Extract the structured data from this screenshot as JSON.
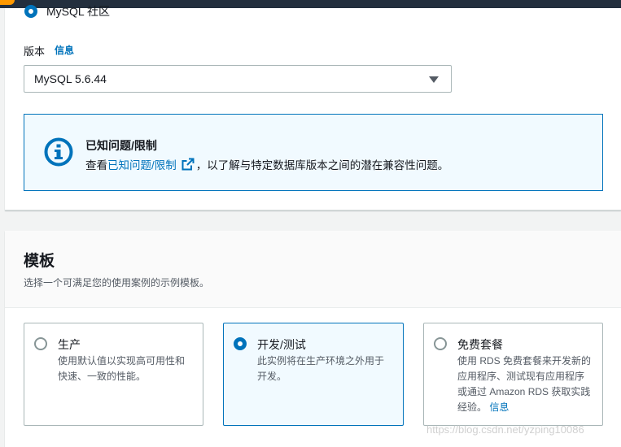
{
  "edition": {
    "label": "MySQL 社区"
  },
  "version": {
    "label": "版本",
    "info_link": "信息",
    "selected": "MySQL 5.6.44"
  },
  "alert": {
    "title": "已知问题/限制",
    "prefix": "查看",
    "link_text": "已知问题/限制",
    "suffix": "，以了解与特定数据库版本之间的潜在兼容性问题。"
  },
  "templates": {
    "title": "模板",
    "description": "选择一个可满足您的使用案例的示例模板。",
    "options": [
      {
        "title": "生产",
        "desc_lines": [
          "使用默认值以实现高可用性和",
          "快速、一致的性能。"
        ],
        "selected": false
      },
      {
        "title": "开发/测试",
        "desc_lines": [
          "此实例将在生产环境之外用于",
          "开发。"
        ],
        "selected": true
      },
      {
        "title": "免费套餐",
        "desc_lines": [
          "使用 RDS 免费套餐来开发新的",
          "应用程序、测试现有应用程序",
          "或通过 Amazon RDS 获取实践",
          "经验。"
        ],
        "info_link": "信息",
        "selected": false
      }
    ]
  },
  "watermark": "https://blog.csdn.net/yzping10086",
  "colors": {
    "accent": "#0073bb",
    "alert_bg": "#f1faff",
    "topbar": "#232f3e"
  }
}
